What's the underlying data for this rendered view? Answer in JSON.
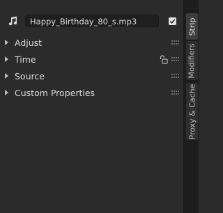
{
  "strip": {
    "name_value": "Happy_Birthday_80_s.mp3",
    "enabled_checked": true
  },
  "sections": [
    {
      "label": "Adjust"
    },
    {
      "label": "Time"
    },
    {
      "label": "Source"
    },
    {
      "label": "Custom Properties"
    }
  ],
  "tabs": [
    {
      "label": "Strip",
      "active": true
    },
    {
      "label": "Modifiers",
      "active": false
    },
    {
      "label": "Proxy & Cache",
      "active": false
    }
  ]
}
